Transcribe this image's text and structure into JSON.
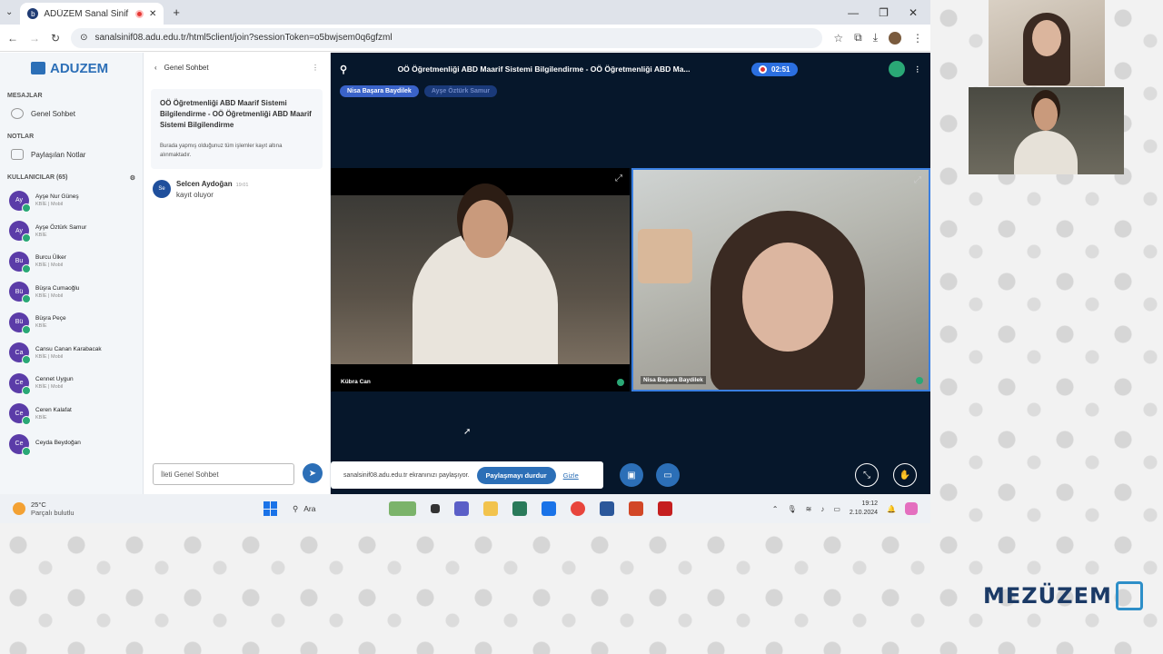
{
  "browser": {
    "tab_title": "ADÜZEM Sanal Sinif - OÖ",
    "url": "sanalsinif08.adu.edu.tr/html5client/join?sessionToken=o5bwjsem0q6gfzml"
  },
  "sidebar": {
    "logo": "ADUZEM",
    "messages_header": "MESAJLAR",
    "public_chat": "Genel Sohbet",
    "notes_header": "NOTLAR",
    "shared_notes": "Paylaşılan Notlar",
    "users_header": "KULLANICILAR (65)",
    "users": [
      {
        "initials": "Ay",
        "name": "Ayşe Nur Güneş",
        "sub": "KBİE | Mobil"
      },
      {
        "initials": "Ay",
        "name": "Ayşe Öztürk Samur",
        "sub": "KBİE"
      },
      {
        "initials": "Bu",
        "name": "Burcu Ülker",
        "sub": "KBİE | Mobil"
      },
      {
        "initials": "Bü",
        "name": "Büşra Cumaoğlu",
        "sub": "KBİE | Mobil"
      },
      {
        "initials": "Bü",
        "name": "Büşra Peçe",
        "sub": "KBİE"
      },
      {
        "initials": "Ca",
        "name": "Cansu Canan Karabacak",
        "sub": "KBİE | Mobil"
      },
      {
        "initials": "Ce",
        "name": "Cennet Uygun",
        "sub": "KBİE | Mobil"
      },
      {
        "initials": "Ce",
        "name": "Ceren Kalafat",
        "sub": "KBİE"
      },
      {
        "initials": "Ce",
        "name": "Ceyda Beydoğan",
        "sub": ""
      }
    ]
  },
  "chat": {
    "header": "Genel Sohbet",
    "welcome_title": "OÖ Öğretmenliği ABD Maarif Sistemi Bilgilendirme - OÖ Öğretmenliği ABD Maarif Sistemi Bilgilendirme",
    "welcome_sub": "Burada yapmış olduğunuz tüm işlemler kayıt altına alınmaktadır.",
    "messages": [
      {
        "initials": "Se",
        "name": "Selcen Aydoğan",
        "time": "19:01",
        "text": "kayıt oluyor"
      }
    ],
    "input_placeholder": "İleti Genel Sohbet"
  },
  "meeting": {
    "title": "OÖ Öğretmenliği ABD Maarif Sistemi Bilgilendirme - OÖ Öğretmenliği ABD Ma...",
    "rec_time": "02:51",
    "talkers": [
      "Nisa Başara Baydilek",
      "Ayşe Öztürk Samur"
    ],
    "video1_name": "Kübra Can",
    "video2_name": "Nisa Başara Baydilek",
    "share_text": "sanalsinif08.adu.edu.tr ekranınızı paylaşıyor.",
    "share_stop": "Paylaşmayı durdur",
    "share_hide": "Gizle"
  },
  "taskbar": {
    "temp": "25°C",
    "weather": "Parçalı bulutlu",
    "search": "Ara",
    "time": "19:12",
    "date": "2.10.2024"
  },
  "brand": {
    "name": "MEZÜZEM"
  }
}
